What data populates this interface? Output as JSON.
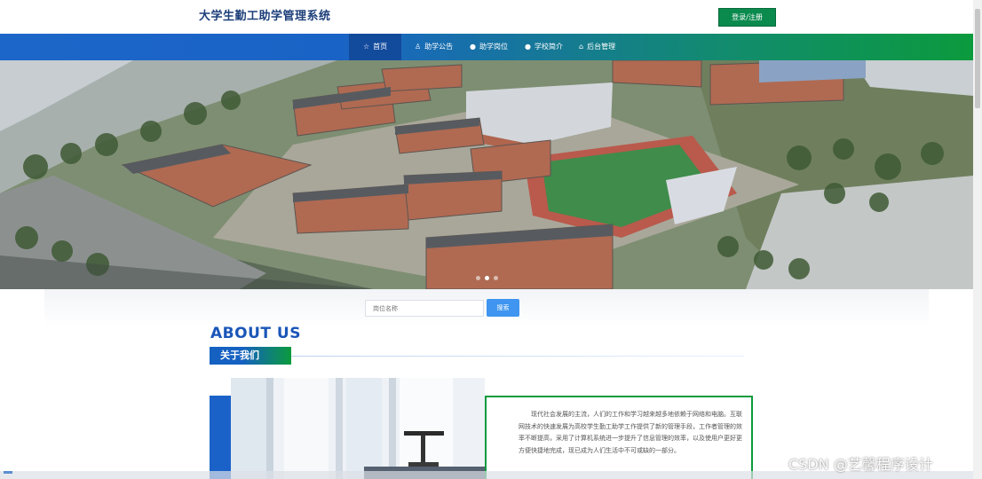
{
  "header": {
    "site_title": "大学生勤工助学管理系统",
    "login_label": "登录/注册"
  },
  "nav": {
    "items": [
      {
        "label": "首页",
        "icon": "star-icon",
        "active": true
      },
      {
        "label": "助学公告",
        "icon": "notice-icon",
        "active": false
      },
      {
        "label": "助学岗位",
        "icon": "dot-icon",
        "active": false
      },
      {
        "label": "学校简介",
        "icon": "dot-icon",
        "active": false
      },
      {
        "label": "后台管理",
        "icon": "admin-icon",
        "active": false
      }
    ]
  },
  "search": {
    "placeholder": "岗位名称",
    "button_label": "搜索"
  },
  "about": {
    "title_en": "ABOUT US",
    "title_cn": "关于我们",
    "text": "现代社会发展的主流，人们的工作和学习越来越多地依赖于网络和电脑。互联网技术的快速发展为高校学生勤工助学工作提供了新的管理手段，工作者管理的效率不断提高，采用了计算机系统进一步提升了信息管理的效率，以及使用户更好更方便快捷地完成，现已成为人们生活中不可或缺的一部分。"
  },
  "watermark": "CSDN @艺馨程序设计",
  "colors": {
    "nav_start": "#1d66c9",
    "nav_end": "#0b9a3d",
    "accent_blue": "#1a56b8",
    "accent_green": "#0b8a4e",
    "search_button": "#3f95f0"
  }
}
